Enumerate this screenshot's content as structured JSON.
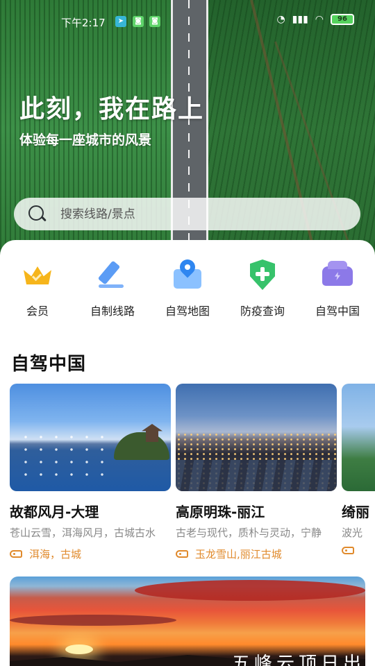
{
  "status": {
    "time": "下午2:17",
    "battery": "96"
  },
  "hero": {
    "title": "此刻，我在路上",
    "subtitle": "体验每一座城市的风景"
  },
  "search": {
    "placeholder": "搜索线路/景点"
  },
  "quick_actions": [
    {
      "label": "会员",
      "icon": "crown-icon",
      "color": "#f6b51b"
    },
    {
      "label": "自制线路",
      "icon": "pencil-icon",
      "color": "#5b9cf5"
    },
    {
      "label": "自驾地图",
      "icon": "map-pin-icon",
      "color": "#2f86f0"
    },
    {
      "label": "防疫查询",
      "icon": "shield-plus-icon",
      "color": "#37c26b"
    },
    {
      "label": "自驾中国",
      "icon": "car-icon",
      "color": "#8c79e8"
    }
  ],
  "section": {
    "title": "自驾中国"
  },
  "routes": [
    {
      "title": "故都风月-大理",
      "desc": "苍山云雪，洱海风月，古城古水",
      "tags": "洱海，古城"
    },
    {
      "title": "高原明珠-丽江",
      "desc": "古老与现代，质朴与灵动，宁静",
      "tags": "玉龙雪山,丽江古城"
    },
    {
      "title": "绮丽",
      "desc": "波光",
      "tags": ""
    }
  ],
  "feature": {
    "caption": "五峰云顶日出"
  },
  "colors": {
    "accent_tag": "#e08a2c",
    "title": "#111111"
  }
}
